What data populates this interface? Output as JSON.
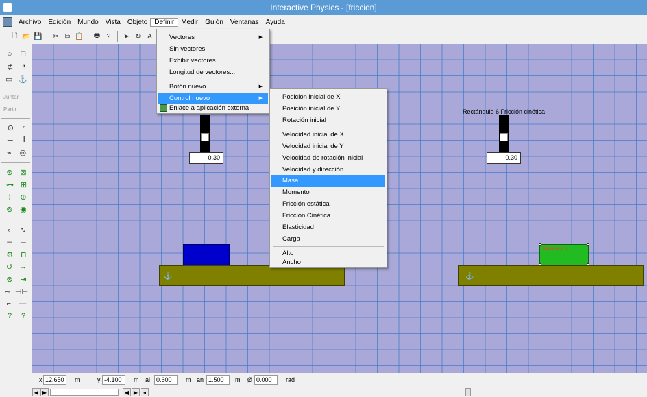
{
  "window": {
    "title": "Interactive Physics - [friccion]"
  },
  "menubar": {
    "items": [
      "Archivo",
      "Edición",
      "Mundo",
      "Vista",
      "Objeto",
      "Definir",
      "Medir",
      "Guión",
      "Ventanas",
      "Ayuda"
    ],
    "active": "Definir"
  },
  "left_toolbar": {
    "join_label": "Juntar",
    "split_label": "Partir"
  },
  "canvas": {
    "control1": {
      "value": "0.30"
    },
    "control2": {
      "label": "Rectángulo 6 Fricción cinética",
      "value": "0.30"
    },
    "green_block_text": "Rectángulo 6"
  },
  "definir_menu": {
    "items": [
      {
        "label": "Vectores",
        "submenu": true
      },
      {
        "label": "Sin vectores"
      },
      {
        "label": "Exhibir vectores..."
      },
      {
        "label": "Longitud de vectores..."
      },
      {
        "label": "Botón nuevo",
        "submenu": true
      },
      {
        "label": "Control nuevo",
        "submenu": true,
        "highlighted": true
      },
      {
        "label": "Enlace a aplicación externa"
      }
    ]
  },
  "control_submenu": {
    "items": [
      "Posición inicial de X",
      "Posición inicial de Y",
      "Rotación inicial",
      "Velocidad inicial de X",
      "Velocidad inicial de Y",
      "Velocidad de rotación inicial",
      "Velocidad y dirección",
      "Masa",
      "Momento",
      "Fricción estática",
      "Fricción Cinética",
      "Elasticidad",
      "Carga",
      "Alto",
      "Ancho"
    ],
    "highlighted": "Masa"
  },
  "statusbar": {
    "x_label": "x",
    "x_value": "12.650",
    "x_unit": "m",
    "y_label": "y",
    "y_value": "-4.100",
    "y_unit": "m",
    "h_label": "al",
    "h_value": "0.600",
    "h_unit": "m",
    "w_label": "an",
    "w_value": "1.500",
    "w_unit": "m",
    "angle_label": "Ø",
    "angle_value": "0.000",
    "angle_unit": "rad"
  }
}
